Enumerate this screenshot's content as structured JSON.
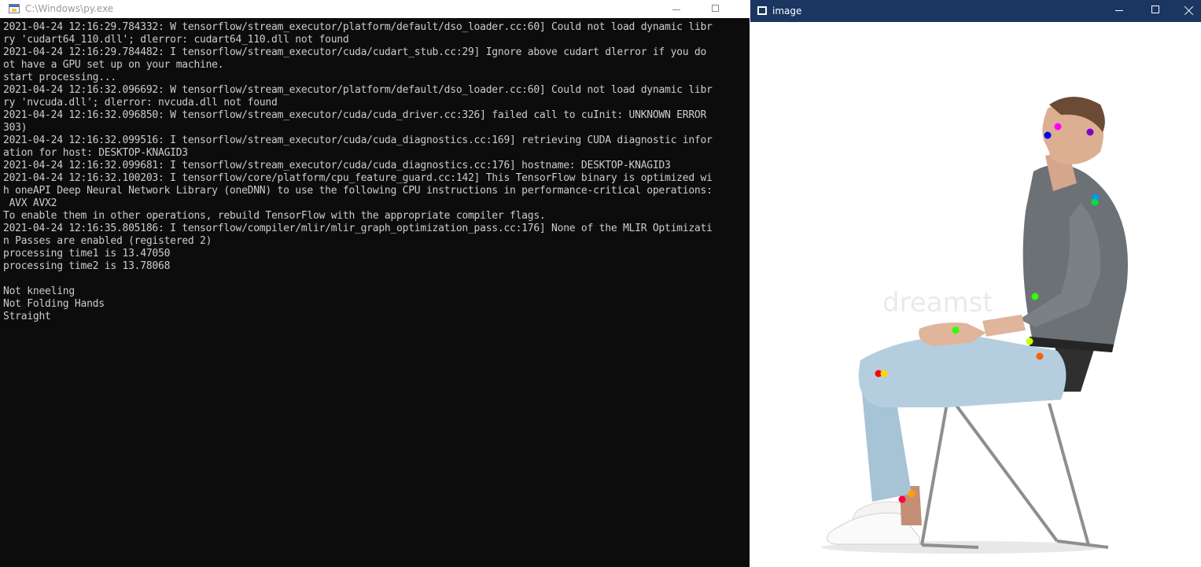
{
  "console_window": {
    "title": "C:\\Windows\\py.exe",
    "lines": [
      "2021-04-24 12:16:29.784332: W tensorflow/stream_executor/platform/default/dso_loader.cc:60] Could not load dynamic libr",
      "ry 'cudart64_110.dll'; dlerror: cudart64_110.dll not found",
      "2021-04-24 12:16:29.784482: I tensorflow/stream_executor/cuda/cudart_stub.cc:29] Ignore above cudart dlerror if you do",
      "ot have a GPU set up on your machine.",
      "start processing...",
      "2021-04-24 12:16:32.096692: W tensorflow/stream_executor/platform/default/dso_loader.cc:60] Could not load dynamic libr",
      "ry 'nvcuda.dll'; dlerror: nvcuda.dll not found",
      "2021-04-24 12:16:32.096850: W tensorflow/stream_executor/cuda/cuda_driver.cc:326] failed call to cuInit: UNKNOWN ERROR",
      "303)",
      "2021-04-24 12:16:32.099516: I tensorflow/stream_executor/cuda/cuda_diagnostics.cc:169] retrieving CUDA diagnostic infor",
      "ation for host: DESKTOP-KNAGID3",
      "2021-04-24 12:16:32.099681: I tensorflow/stream_executor/cuda/cuda_diagnostics.cc:176] hostname: DESKTOP-KNAGID3",
      "2021-04-24 12:16:32.100203: I tensorflow/core/platform/cpu_feature_guard.cc:142] This TensorFlow binary is optimized wi",
      "h oneAPI Deep Neural Network Library (oneDNN) to use the following CPU instructions in performance-critical operations:",
      " AVX AVX2",
      "To enable them in other operations, rebuild TensorFlow with the appropriate compiler flags.",
      "2021-04-24 12:16:35.805186: I tensorflow/compiler/mlir/mlir_graph_optimization_pass.cc:176] None of the MLIR Optimizati",
      "n Passes are enabled (registered 2)",
      "processing time1 is 13.47050",
      "processing time2 is 13.78068",
      "",
      "Not kneeling",
      "Not Folding Hands",
      "Straight"
    ]
  },
  "image_window": {
    "title": "image",
    "watermark": "dreamst",
    "keypoint_colors": [
      "#0000ff",
      "#ff00ff",
      "#8000c8",
      "#0090ff",
      "#00e040",
      "#30ff00",
      "#80ff00",
      "#c8ff00",
      "#ff6000",
      "#ff0000",
      "#ffd800",
      "#ff0040",
      "#ffa000"
    ]
  }
}
